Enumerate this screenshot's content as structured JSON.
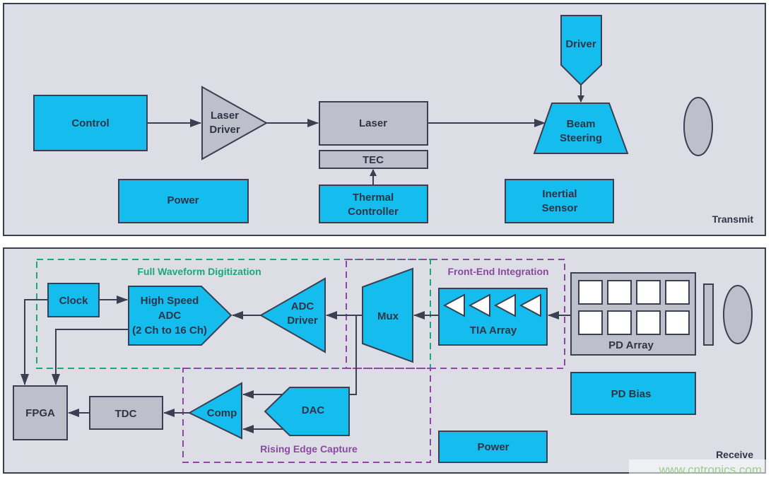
{
  "transmit": {
    "section_label": "Transmit",
    "blocks": {
      "control": "Control",
      "laser_driver": [
        "Laser",
        "Driver"
      ],
      "laser": "Laser",
      "tec": "TEC",
      "thermal_controller": [
        "Thermal",
        "Controller"
      ],
      "driver": "Driver",
      "beam_steering": [
        "Beam",
        "Steering"
      ],
      "power": "Power",
      "inertial_sensor": [
        "Inertial",
        "Sensor"
      ]
    }
  },
  "receive": {
    "section_label": "Receive",
    "groups": {
      "full_waveform": "Full Waveform Digitization",
      "front_end": "Front-End Integration",
      "rising_edge": "Rising Edge Capture"
    },
    "blocks": {
      "clock": "Clock",
      "high_speed_adc": [
        "High Speed",
        "ADC",
        "(2 Ch to 16 Ch)"
      ],
      "adc_driver": [
        "ADC",
        "Driver"
      ],
      "mux": "Mux",
      "tia_array": "TIA Array",
      "pd_array": "PD Array",
      "pd_bias": "PD Bias",
      "fpga": "FPGA",
      "tdc": "TDC",
      "comp": "Comp",
      "dac": "DAC",
      "power": "Power"
    },
    "pd_array_cells": 8,
    "tia_count": 4
  },
  "colors": {
    "panel_bg": "#dcdde5",
    "block_blue": "#14bdee",
    "block_gray": "#bdbfca",
    "outline": "#3b3f52",
    "group_green": "#1aa87a",
    "group_purple": "#8a4aa0"
  },
  "watermark": "www.cntronics.com"
}
